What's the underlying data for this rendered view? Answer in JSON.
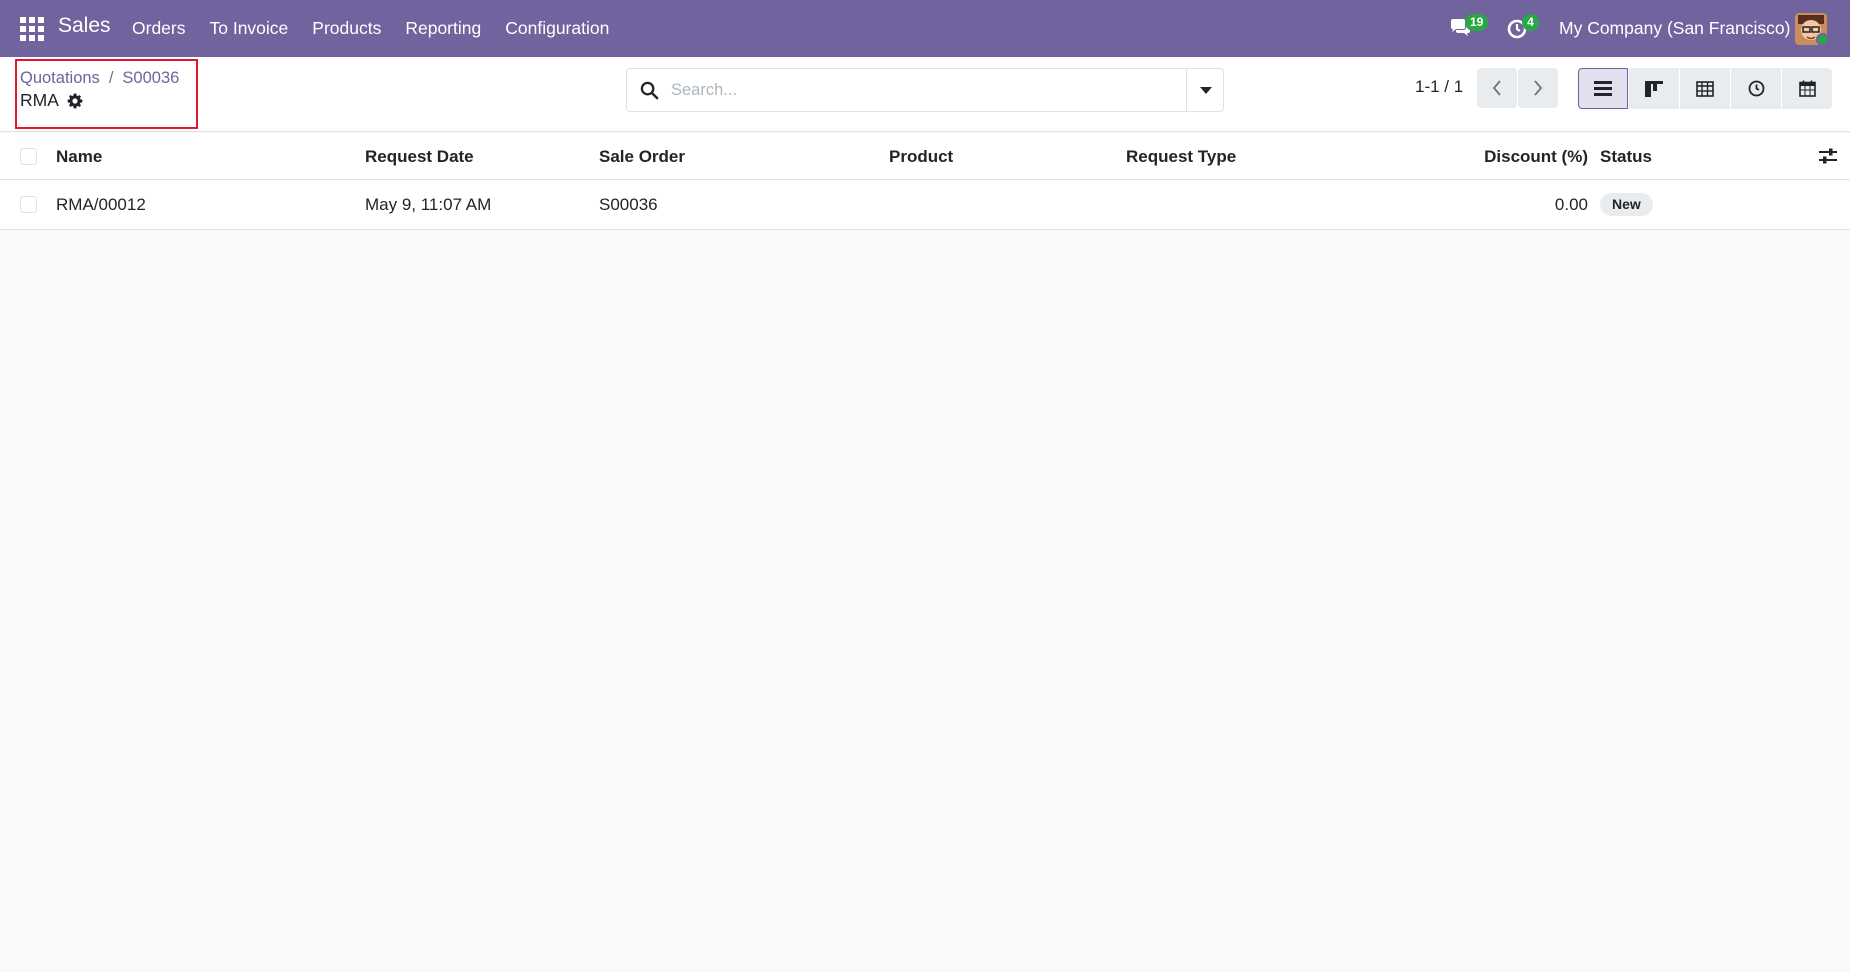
{
  "navbar": {
    "app_name": "Sales",
    "menu": [
      "Orders",
      "To Invoice",
      "Products",
      "Reporting",
      "Configuration"
    ],
    "messages_count": "19",
    "activities_count": "4",
    "company": "My Company (San Francisco)"
  },
  "control_panel": {
    "breadcrumbs": [
      "Quotations",
      "S00036"
    ],
    "breadcrumb_separator": "/",
    "current": "RMA",
    "search_placeholder": "Search...",
    "pager": "1-1 / 1",
    "views": [
      "list",
      "kanban",
      "pivot",
      "activity",
      "calendar"
    ],
    "active_view": "list"
  },
  "table": {
    "columns": [
      "Name",
      "Request Date",
      "Sale Order",
      "Product",
      "Request Type",
      "Discount (%)",
      "Status"
    ],
    "rows": [
      {
        "name": "RMA/00012",
        "request_date": "May 9, 11:07 AM",
        "sale_order": "S00036",
        "product": "",
        "request_type": "",
        "discount": "0.00",
        "status": "New"
      }
    ]
  },
  "colors": {
    "brand": "#71639e",
    "highlight_border": "#e0182f",
    "badge_green": "#28a745"
  }
}
